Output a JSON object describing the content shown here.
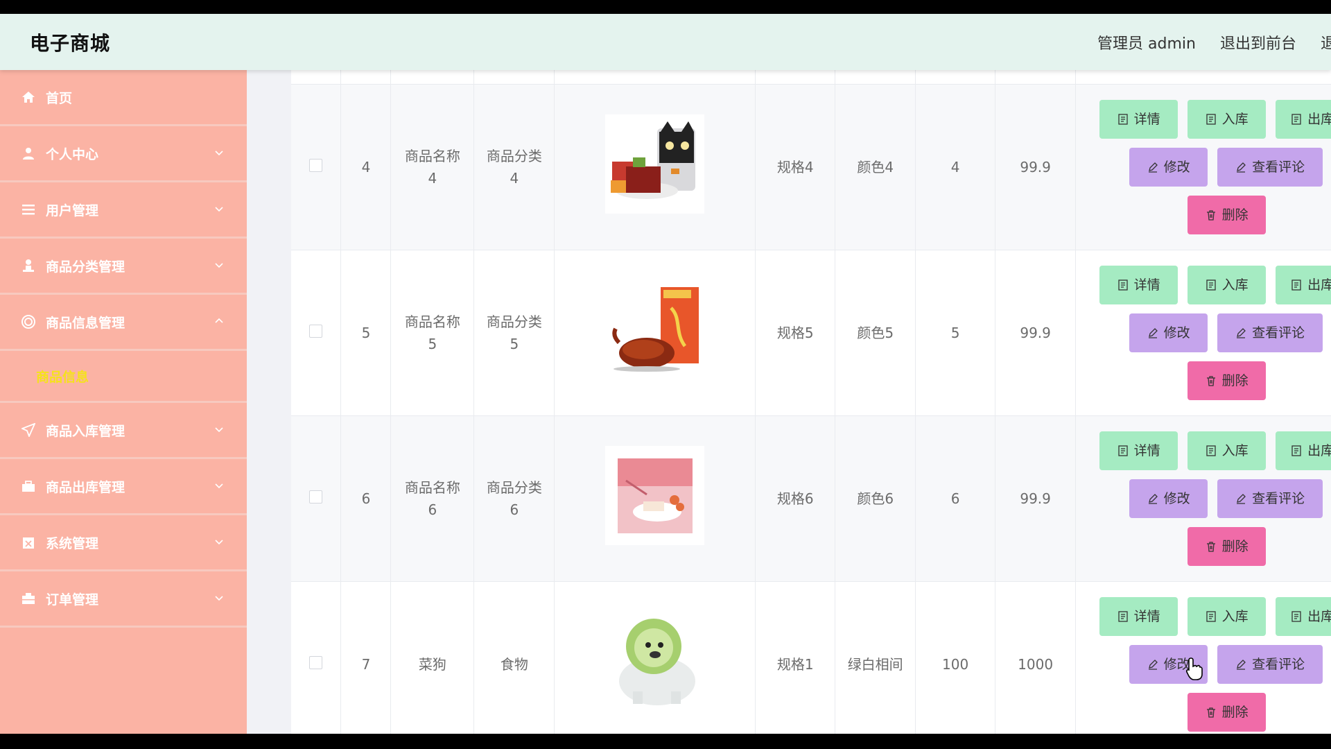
{
  "header": {
    "title": "电子商城",
    "admin_label": "管理员 admin",
    "exit_label": "退出到前台",
    "cut_label": "退"
  },
  "sidebar": {
    "items": [
      {
        "label": "首页",
        "icon": "home-icon",
        "chevron": false
      },
      {
        "label": "个人中心",
        "icon": "user-icon",
        "chevron": true
      },
      {
        "label": "用户管理",
        "icon": "list-icon",
        "chevron": true
      },
      {
        "label": "商品分类管理",
        "icon": "person-icon",
        "chevron": true
      },
      {
        "label": "商品信息管理",
        "icon": "target-icon",
        "chevron": true,
        "expanded": true
      },
      {
        "label": "商品入库管理",
        "icon": "send-icon",
        "chevron": true
      },
      {
        "label": "商品出库管理",
        "icon": "briefcase-icon",
        "chevron": true
      },
      {
        "label": "系统管理",
        "icon": "clipboard-icon",
        "chevron": true
      },
      {
        "label": "订单管理",
        "icon": "case-icon",
        "chevron": true
      }
    ],
    "subitem_label": "商品信息"
  },
  "buttons": {
    "detail": "详情",
    "stock_in": "入库",
    "stock_out": "出库",
    "edit": "修改",
    "comments": "查看评论",
    "delete": "删除"
  },
  "rows": [
    {
      "id": "4",
      "name": "商品名称\n4",
      "category": "商品分类\n4",
      "image": "snack-pack",
      "spec": "规格4",
      "color": "颜色4",
      "qty": "4",
      "price": "99.9"
    },
    {
      "id": "5",
      "name": "商品名称\n5",
      "category": "商品分类\n5",
      "image": "roast-duck",
      "spec": "规格5",
      "color": "颜色5",
      "qty": "5",
      "price": "99.9"
    },
    {
      "id": "6",
      "name": "商品名称\n6",
      "category": "商品分类\n6",
      "image": "pink-dessert",
      "spec": "规格6",
      "color": "颜色6",
      "qty": "6",
      "price": "99.9"
    },
    {
      "id": "7",
      "name": "菜狗",
      "category": "食物",
      "image": "cabbage-dog",
      "spec": "规格1",
      "color": "绿白相间",
      "qty": "100",
      "price": "1000"
    }
  ]
}
